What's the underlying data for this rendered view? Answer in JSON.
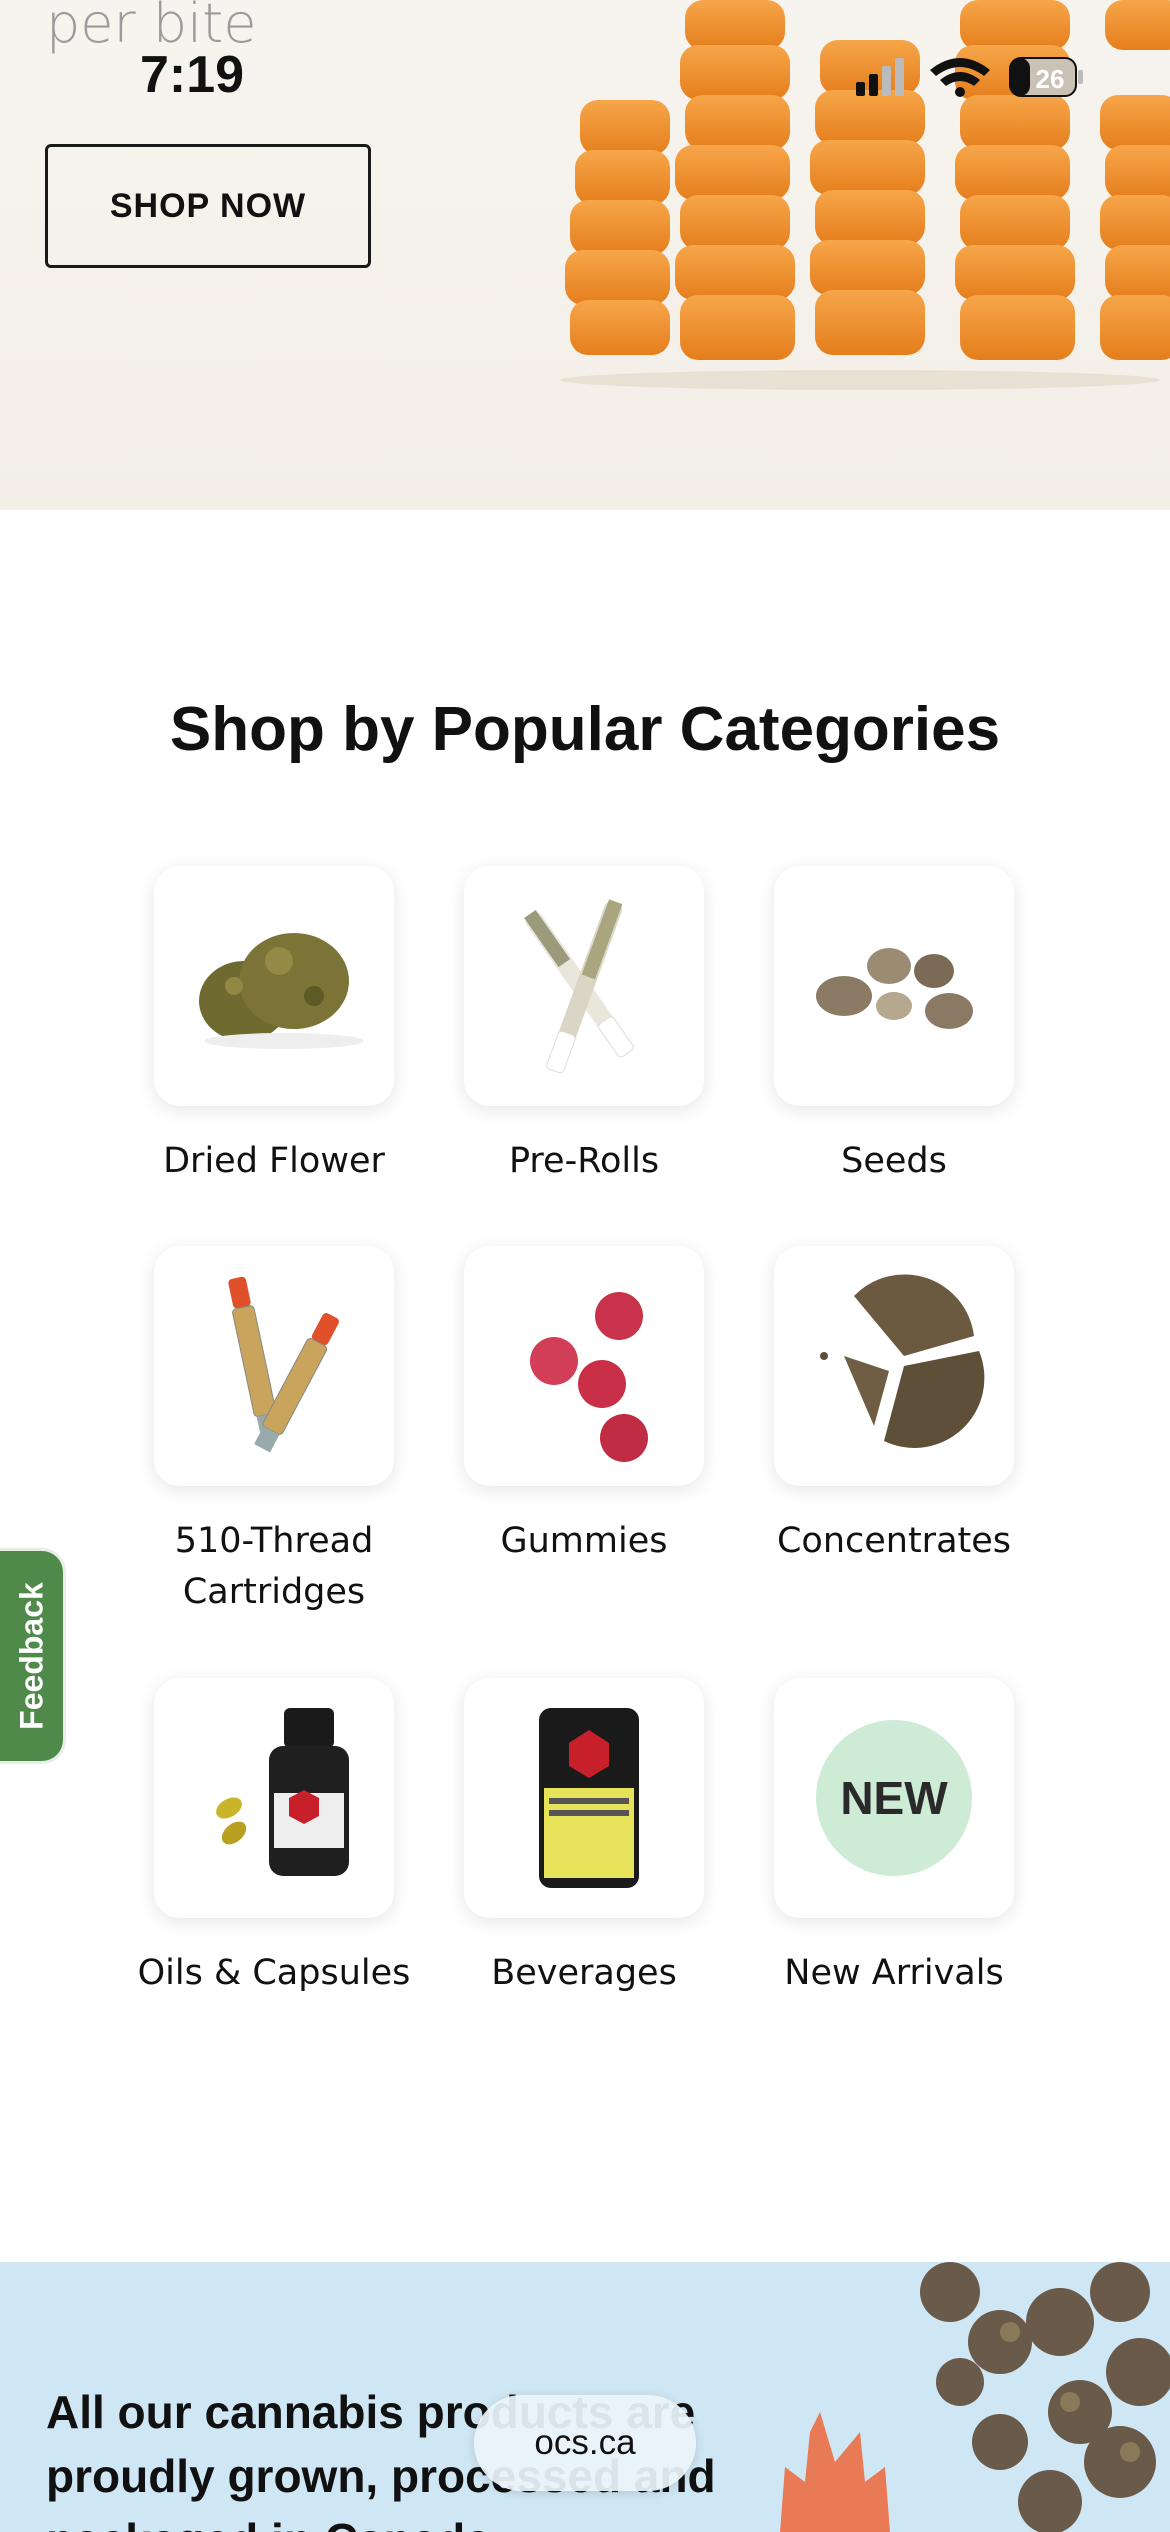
{
  "status_bar": {
    "time": "7:19",
    "battery": "26"
  },
  "hero": {
    "tagline": "per bite",
    "cta_label": "SHOP NOW"
  },
  "section": {
    "title": "Shop by Popular Categories"
  },
  "categories": [
    {
      "label": "Dried Flower",
      "icon": "dried-flower"
    },
    {
      "label": "Pre-Rolls",
      "icon": "pre-rolls"
    },
    {
      "label": "Seeds",
      "icon": "seeds"
    },
    {
      "label": "510-Thread Cartridges",
      "icon": "cartridges"
    },
    {
      "label": "Gummies",
      "icon": "gummies"
    },
    {
      "label": "Concentrates",
      "icon": "concentrates"
    },
    {
      "label": "Oils & Capsules",
      "icon": "oils-capsules"
    },
    {
      "label": "Beverages",
      "icon": "beverages"
    },
    {
      "label": "New Arrivals",
      "icon": "new-arrivals",
      "badge": "NEW"
    }
  ],
  "feedback": {
    "label": "Feedback"
  },
  "banner": {
    "text": "All our cannabis products are proudly grown, processed and packaged in Canada"
  },
  "browser": {
    "url": "ocs.ca"
  },
  "colors": {
    "feedback_green": "#4f8a4b",
    "banner_blue": "#cfe7f5",
    "new_badge": "#cdebd5"
  }
}
